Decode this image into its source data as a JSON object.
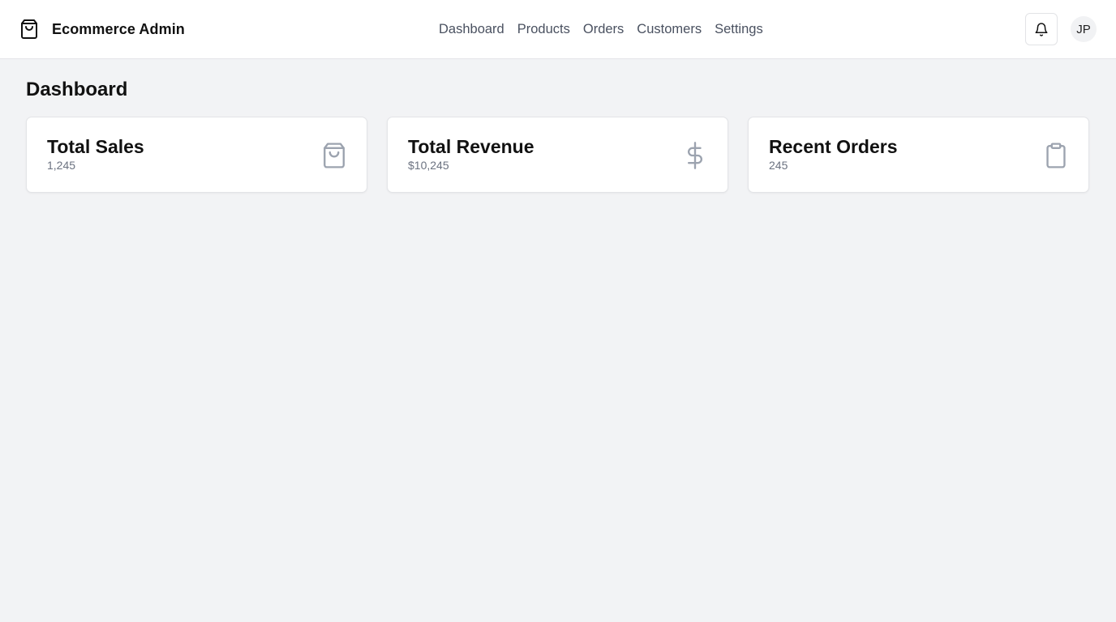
{
  "header": {
    "brand_title": "Ecommerce Admin",
    "brand_icon": "shopping-bag-icon",
    "nav": [
      {
        "label": "Dashboard"
      },
      {
        "label": "Products"
      },
      {
        "label": "Orders"
      },
      {
        "label": "Customers"
      },
      {
        "label": "Settings"
      }
    ],
    "notification_icon": "bell-icon",
    "avatar_initials": "JP"
  },
  "main": {
    "page_title": "Dashboard",
    "cards": [
      {
        "title": "Total Sales",
        "value": "1,245",
        "icon": "shopping-bag-icon"
      },
      {
        "title": "Total Revenue",
        "value": "$10,245",
        "icon": "dollar-icon"
      },
      {
        "title": "Recent Orders",
        "value": "245",
        "icon": "clipboard-icon"
      }
    ]
  },
  "colors": {
    "background": "#f2f3f5",
    "surface": "#ffffff",
    "text_primary": "#111111",
    "text_muted": "#6b7280",
    "icon_muted": "#9ca3af"
  }
}
